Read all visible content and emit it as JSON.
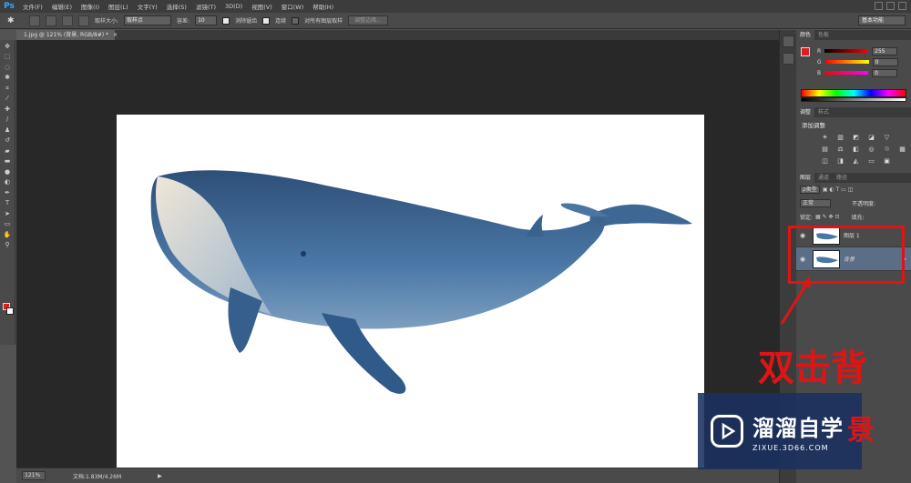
{
  "app": {
    "logo": "Ps"
  },
  "menu": [
    "文件(F)",
    "编辑(E)",
    "图像(I)",
    "图层(L)",
    "文字(Y)",
    "选择(S)",
    "滤镜(T)",
    "3D(D)",
    "视图(V)",
    "窗口(W)",
    "帮助(H)"
  ],
  "options": {
    "sample_size_label": "取样大小:",
    "sample_size_value": "取样点",
    "tolerance_label": "容差:",
    "tolerance_value": "10",
    "antialias_label": "消除锯齿",
    "contiguous_label": "连续",
    "all_layers_label": "对所有图层取样",
    "refine_edge_label": "调整边缘...",
    "workspace": "基本功能"
  },
  "document": {
    "tab_title": "1.jpg @ 121% (背景, RGB/8#) *",
    "close": "×"
  },
  "status": {
    "zoom": "121%",
    "doc_info": "文档:1.83M/4.26M",
    "arrow": "▶"
  },
  "panels": {
    "color_tabs": [
      "颜色",
      "色板"
    ],
    "color_rows": [
      {
        "channel": "R",
        "value": "255"
      },
      {
        "channel": "G",
        "value": "0"
      },
      {
        "channel": "B",
        "value": "0"
      }
    ],
    "adjust_tabs": [
      "调整",
      "样式"
    ],
    "adjust_title": "添加调整",
    "layers_tabs": [
      "图层",
      "通道",
      "路径"
    ],
    "kind_filter": "ρ类型",
    "blend_mode": "正常",
    "opacity_label": "不透明度:",
    "lock_label": "锁定:",
    "fill_label": "填充:",
    "layers": [
      {
        "name": "图层 1",
        "selected": false
      },
      {
        "name": "背景",
        "selected": true
      }
    ]
  },
  "annotation": {
    "text_main": "双击背",
    "text_extra": "景"
  },
  "watermark": {
    "title": "溜溜自学",
    "url": "ZIXUE.3D66.COM"
  },
  "colors": {
    "accent_red": "#e01414",
    "foreground": "#e01c1c",
    "selection": "#5c6d86"
  }
}
